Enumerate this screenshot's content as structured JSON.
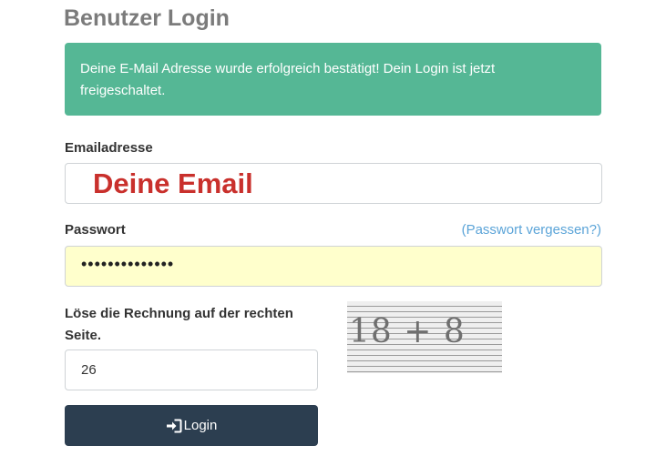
{
  "page": {
    "title": "Benutzer Login"
  },
  "alert": {
    "message": "Deine E-Mail Adresse wurde erfolgreich bestätigt! Dein Login ist jetzt freigeschaltet.",
    "color": "#55b795"
  },
  "email": {
    "label": "Emailadresse",
    "value": "Deine Email"
  },
  "password": {
    "label": "Passwort",
    "forgot_link": "(Passwort vergessen?)",
    "masked_value": "••••••••••••••",
    "fill_color": "#ffffcc"
  },
  "captcha": {
    "question": "Löse die Rechnung auf der rechten Seite.",
    "answer_value": "26",
    "image_text": "18 + 8"
  },
  "login_button": {
    "label": "Login",
    "icon": "sign-in-icon",
    "color": "#2c3e50"
  }
}
